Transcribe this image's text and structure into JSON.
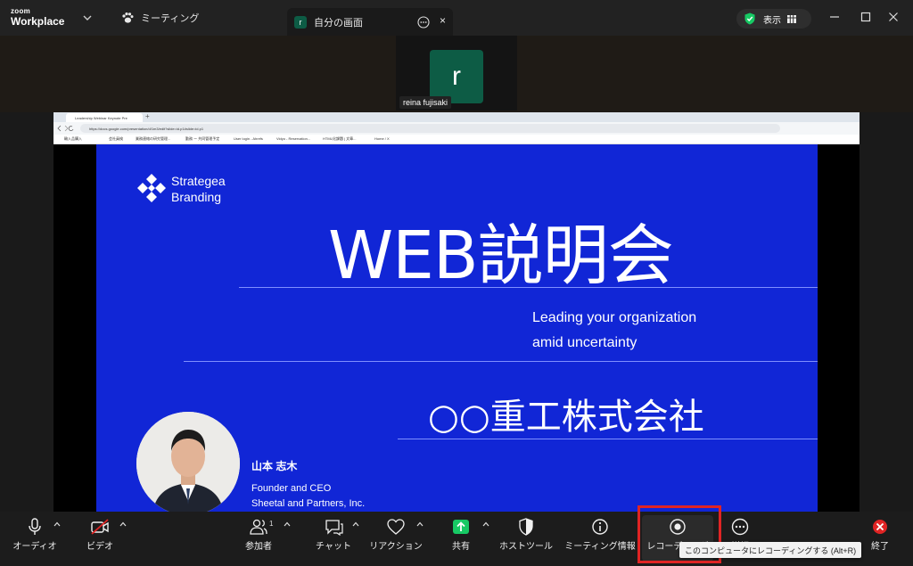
{
  "app": {
    "brand_top": "zoom",
    "brand_bottom": "Workplace"
  },
  "tabs": {
    "meeting_label": "ミーティング",
    "share_label": "自分の画面",
    "share_avatar": "r"
  },
  "view_button": {
    "label": "表示"
  },
  "participant": {
    "avatar_letter": "r",
    "name": "reina fujisaki"
  },
  "browser": {
    "tab_title": "Leadership Webinar Keynote Pre",
    "url": "https://docs.google.com/presentation/d/1m3/edit?slide=id.p1#slide=id.p1",
    "bookmarks": [
      "輸入品購入",
      "会社員検",
      "業務連絡の研究管理...",
      "勤務 ー 共同管理予定",
      "User login - Ahrefs",
      "Vidyo - Reservation...",
      "HTML化課題 | 文章...",
      "Home / X"
    ]
  },
  "slide": {
    "brand_line1": "Strategea",
    "brand_line2": "Branding",
    "title": "WEB説明会",
    "subtitle_line1": "Leading your organization",
    "subtitle_line2": "amid uncertainty",
    "company": "○○重工株式会社",
    "presenter_name": "山本 志木",
    "presenter_title1": "Founder and CEO",
    "presenter_title2": "Sheetal and Partners, Inc."
  },
  "toolbar": {
    "audio": "オーディオ",
    "video": "ビデオ",
    "participants": "参加者",
    "participants_count": "1",
    "chat": "チャット",
    "reactions": "リアクション",
    "share": "共有",
    "host_tools": "ホストツール",
    "meeting_info": "ミーティング情報",
    "recording": "レコーディング",
    "more": "詳細",
    "end": "終了"
  },
  "tooltip": {
    "text": "このコンピュータにレコーディングする (Alt+R)"
  },
  "colors": {
    "slide_bg": "#1126d6",
    "accent_green": "#17c964",
    "avatar_green": "#0d5c45",
    "end_red": "#e02424",
    "highlight_red": "#e02424"
  }
}
